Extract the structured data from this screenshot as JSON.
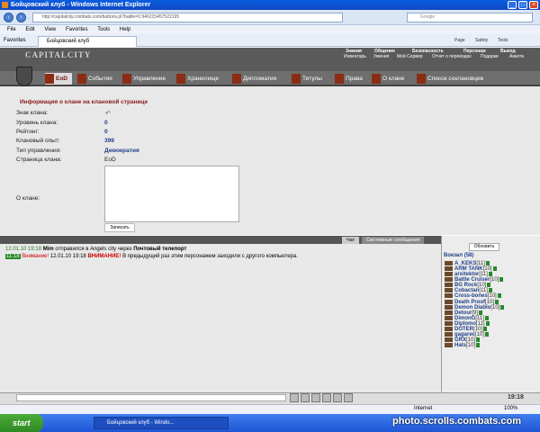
{
  "window": {
    "title": "Бойцовский клуб - Windows Internet Explorer"
  },
  "browser": {
    "url": "http://capitalcity.combats.com/buttons.pl?battle=0.946215457522195",
    "search_placeholder": "Google",
    "menu": [
      "File",
      "Edit",
      "View",
      "Favorites",
      "Tools",
      "Help"
    ],
    "favorites_label": "Favorites",
    "tab_title": "Бойцовский клуб",
    "tools": [
      "Page",
      "Safety",
      "Tools"
    ]
  },
  "game": {
    "logo": "CAPITALCITY",
    "top_menu": [
      "Знания",
      "Общение",
      "Безопасность",
      "Персонаж",
      "Выход"
    ],
    "sub_menu": [
      "Инвентарь",
      "Умения",
      "Мой Сервер",
      "Отчет о переводах",
      "Подарки",
      "Анкета"
    ],
    "tabs": [
      "EoD",
      "События",
      "Управление",
      "Хранилище",
      "Дипломатия",
      "Титулы",
      "Права",
      "О клане",
      "Список соклановцев"
    ]
  },
  "clan_info": {
    "title": "Информация о клане на клановой странице",
    "fields": [
      {
        "label": "Знак клана:",
        "value": ""
      },
      {
        "label": "Уровень клана:",
        "value": "0"
      },
      {
        "label": "Рейтинг:",
        "value": "0"
      },
      {
        "label": "Клановый опыт:",
        "value": "399"
      },
      {
        "label": "Тип управления:",
        "value": "Демократия"
      },
      {
        "label": "Страница клана:",
        "value": "EoD"
      },
      {
        "label": "О клане:",
        "value": ""
      }
    ],
    "save_label": "Записать"
  },
  "chat": {
    "tabs": [
      "Чат",
      "Системные сообщения"
    ],
    "messages": [
      {
        "time": "12.01.10 19:18",
        "user": "Mim",
        "text": "отправился в",
        "place": "Angels city",
        "via": "через",
        "item": "Почтовый телепорт"
      },
      {
        "prefix": "Внимание!",
        "time": "12.01.10 19:18",
        "warn": "ВНИМАНИЕ!",
        "text": "В предыдущий раз этим персонажем заходили с другого компьютера."
      }
    ]
  },
  "online": {
    "refresh_label": "Обновить",
    "location": "Вокзал (58)",
    "players": [
      {
        "name": "A_KEKS",
        "level": "[11]"
      },
      {
        "name": "ARM TANK",
        "level": "[10]"
      },
      {
        "name": "arxitektor",
        "level": "[11]"
      },
      {
        "name": "Battle Cruiser",
        "level": "[10]"
      },
      {
        "name": "BG Rock",
        "level": "[10]"
      },
      {
        "name": "Cobactan",
        "level": "[11]"
      },
      {
        "name": "Cross-bones",
        "level": "[10]"
      },
      {
        "name": "Death Proof",
        "level": "[10]"
      },
      {
        "name": "Demon Diablo",
        "level": "[10]"
      },
      {
        "name": "Detour",
        "level": "[9]"
      },
      {
        "name": "DimonG",
        "level": "[11]"
      },
      {
        "name": "Diplomo",
        "level": "[11]"
      },
      {
        "name": "DOTER",
        "level": "[10]"
      },
      {
        "name": "gagarec",
        "level": "[10]"
      },
      {
        "name": "GRX",
        "level": "[10]"
      },
      {
        "name": "Hats",
        "level": "[10]"
      }
    ]
  },
  "statusbar": {
    "zone": "Internet",
    "zoom": "100%"
  },
  "taskbar": {
    "start": "start",
    "task": "Бойцовский клуб - Windo...",
    "clock": "19:18"
  },
  "watermark": "photo.scrolls.combats.com"
}
